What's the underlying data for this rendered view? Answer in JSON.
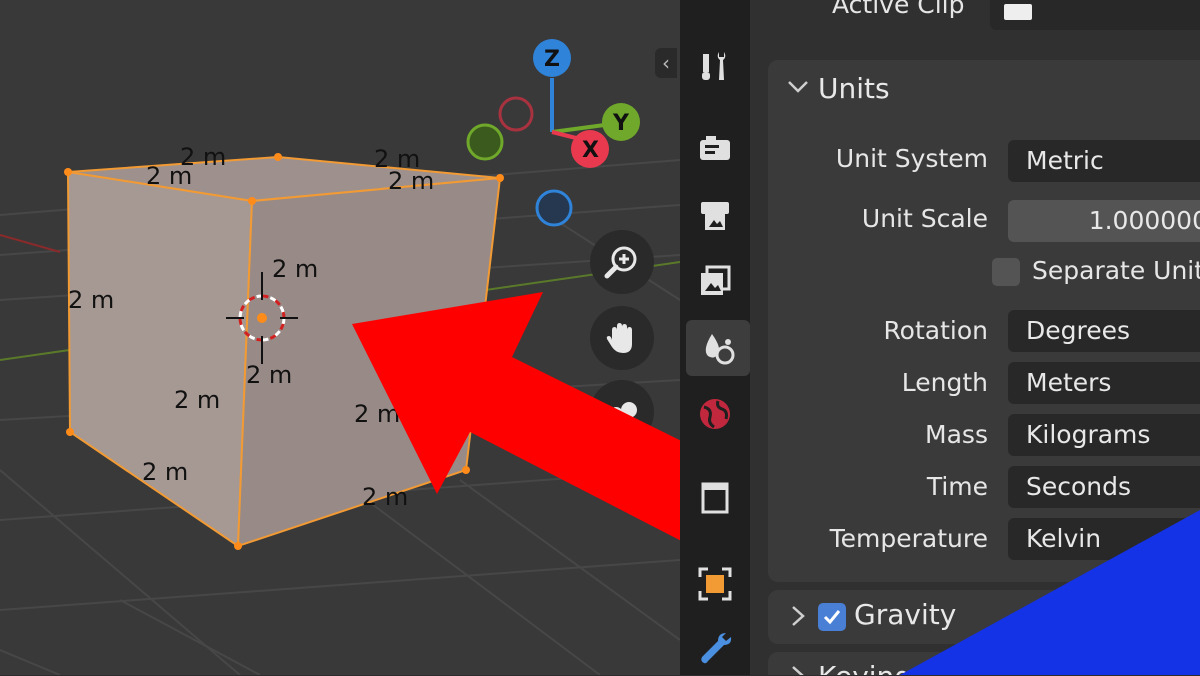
{
  "viewport": {
    "dimensions": {
      "top_back": "2 m",
      "top_left": "2 m",
      "top_right_back": "2 m",
      "top_right": "2 m",
      "front_vertical_upper": "2 m",
      "left_vertical": "2 m",
      "center_lower": "2 m",
      "front_left_bottom": "2 m",
      "right_side": "2 m",
      "bottom_left": "2 m",
      "bottom_right": "2 m"
    },
    "gizmo": {
      "z": "Z",
      "y": "Y",
      "x": "X"
    },
    "colors": {
      "z": "#2f83d9",
      "y": "#6fa82a",
      "x": "#e8394e",
      "cube_face": "#a89c98",
      "selection": "#f29a34",
      "arrow": "#ff0000"
    }
  },
  "tabs": [
    {
      "name": "tool-tab-icon"
    },
    {
      "name": "render-tab-icon"
    },
    {
      "name": "output-tab-icon"
    },
    {
      "name": "view-layer-tab-icon"
    },
    {
      "name": "scene-tab-icon",
      "active": true
    },
    {
      "name": "world-tab-icon"
    },
    {
      "name": "collection-tab-icon"
    },
    {
      "name": "object-tab-icon"
    },
    {
      "name": "modifier-tab-icon"
    }
  ],
  "properties": {
    "active_clip_label": "Active Clip",
    "units": {
      "title": "Units",
      "unit_system_label": "Unit System",
      "unit_system_value": "Metric",
      "unit_scale_label": "Unit Scale",
      "unit_scale_value": "1.000000",
      "separate_units_label": "Separate Units",
      "rotation_label": "Rotation",
      "rotation_value": "Degrees",
      "length_label": "Length",
      "length_value": "Meters",
      "mass_label": "Mass",
      "mass_value": "Kilograms",
      "time_label": "Time",
      "time_value": "Seconds",
      "temperature_label": "Temperature",
      "temperature_value": "Kelvin"
    },
    "gravity": {
      "title": "Gravity",
      "checked": true
    },
    "keying_title": "Keying Sets"
  }
}
